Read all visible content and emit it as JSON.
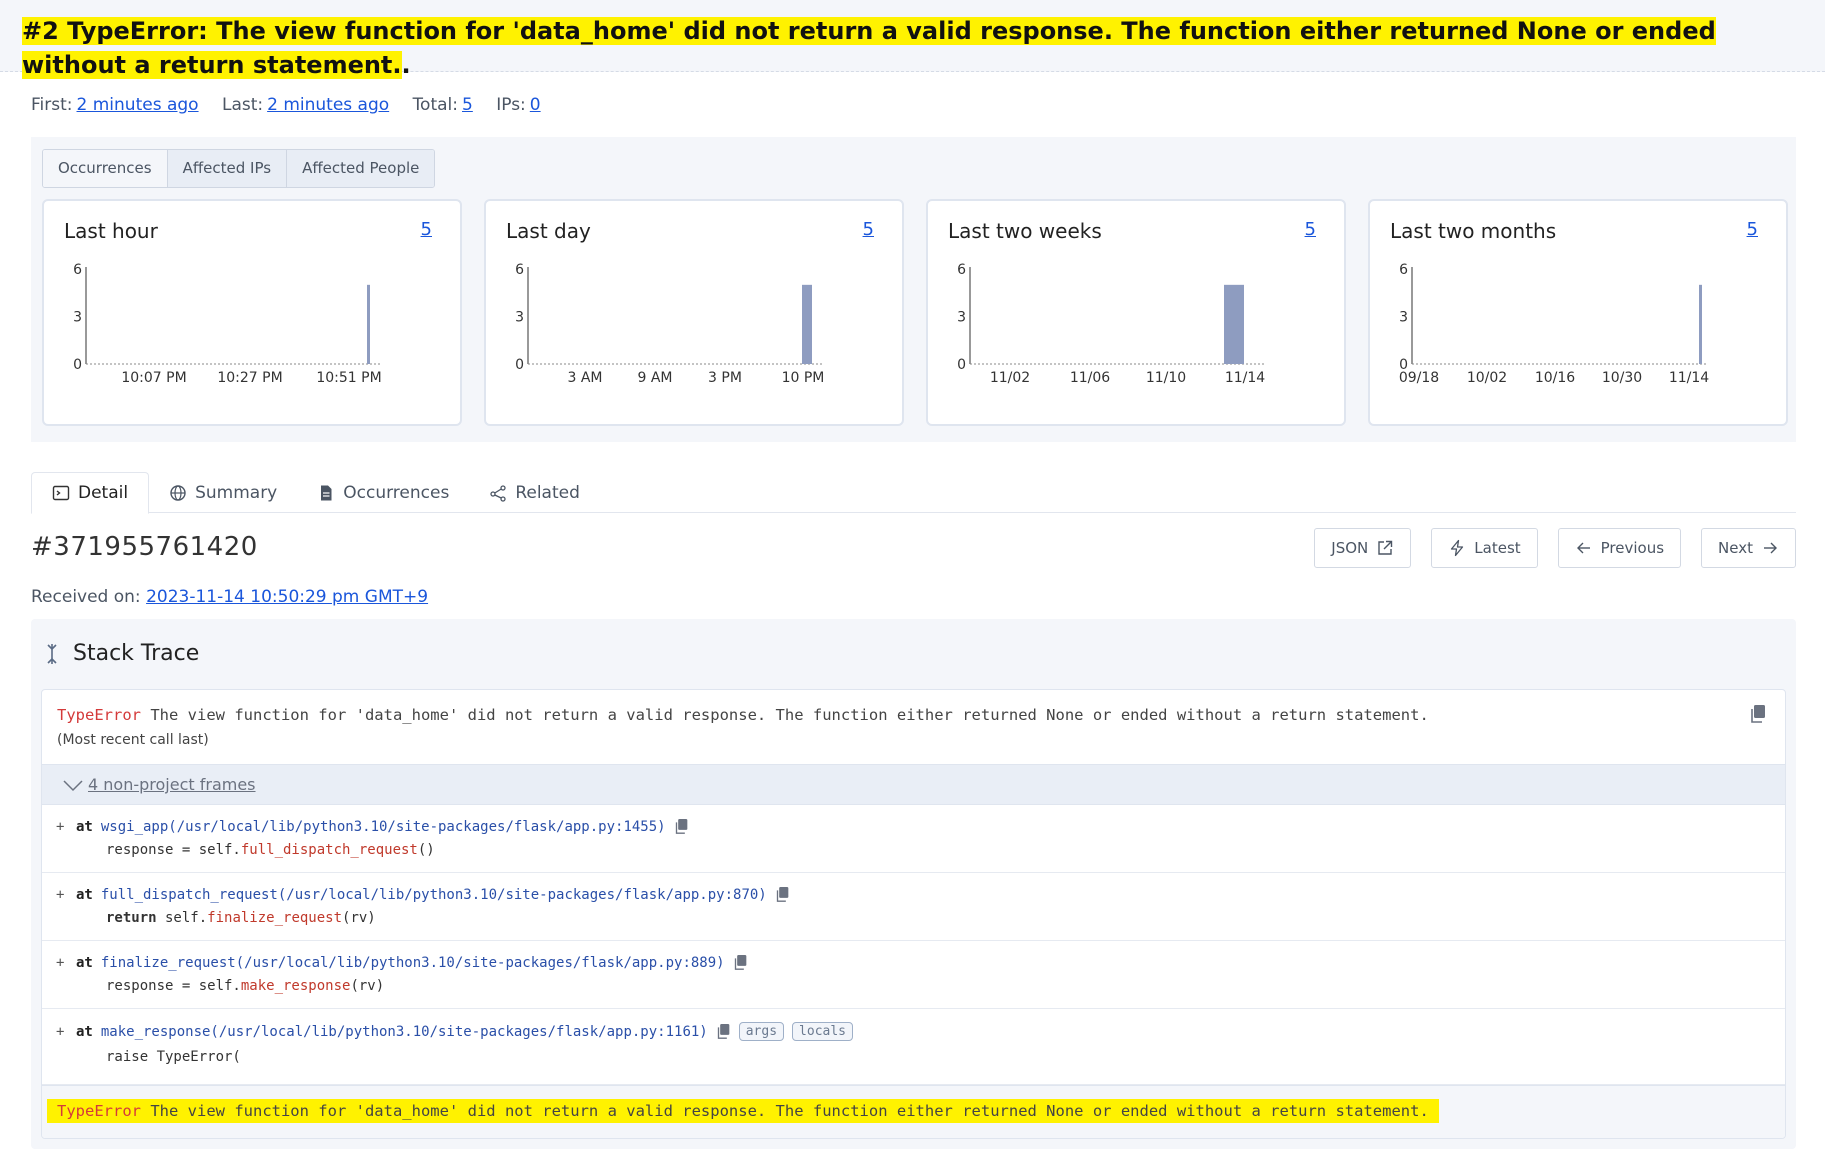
{
  "title": {
    "text": "#2 TypeError: The view function for 'data_home' did not return a valid response. The function either returned None or ended without a return statement.",
    "period": "."
  },
  "meta": {
    "first_label": "First:",
    "first_value": "2 minutes ago",
    "last_label": "Last:",
    "last_value": "2 minutes ago",
    "total_label": "Total:",
    "total_value": "5",
    "ips_label": "IPs:",
    "ips_value": "0"
  },
  "stat_tabs": [
    "Occurrences",
    "Affected IPs",
    "Affected People"
  ],
  "chart_data": [
    {
      "type": "bar",
      "title": "Last hour",
      "count": "5",
      "ylim": [
        0,
        6
      ],
      "yticks": [
        "6",
        "3",
        "0"
      ],
      "xticks": [
        "10:07 PM",
        "10:27 PM",
        "10:51 PM"
      ],
      "bars": [
        {
          "x": "10:51 PM",
          "value": 5
        }
      ]
    },
    {
      "type": "bar",
      "title": "Last day",
      "count": "5",
      "ylim": [
        0,
        6
      ],
      "yticks": [
        "6",
        "3",
        "0"
      ],
      "xticks": [
        "3 AM",
        "9 AM",
        "3 PM",
        "10 PM"
      ],
      "bars": [
        {
          "x": "10 PM",
          "value": 5
        }
      ]
    },
    {
      "type": "bar",
      "title": "Last two weeks",
      "count": "5",
      "ylim": [
        0,
        6
      ],
      "yticks": [
        "6",
        "3",
        "0"
      ],
      "xticks": [
        "11/02",
        "11/06",
        "11/10",
        "11/14"
      ],
      "bars": [
        {
          "x": "11/14",
          "value": 5
        }
      ]
    },
    {
      "type": "bar",
      "title": "Last two months",
      "count": "5",
      "ylim": [
        0,
        6
      ],
      "yticks": [
        "6",
        "3",
        "0"
      ],
      "xticks": [
        "09/18",
        "10/02",
        "10/16",
        "10/30",
        "11/14"
      ],
      "bars": [
        {
          "x": "11/14",
          "value": 5
        }
      ]
    }
  ],
  "detail_tabs": [
    "Detail",
    "Summary",
    "Occurrences",
    "Related"
  ],
  "event": {
    "id": "#371955761420",
    "received_label": "Received on:",
    "received_value": "2023-11-14 10:50:29 pm GMT+9"
  },
  "buttons": {
    "json": "JSON",
    "latest": "Latest",
    "previous": "Previous",
    "next": "Next"
  },
  "stack": {
    "header": "Stack Trace",
    "error_type": "TypeError",
    "error_message": " The view function for 'data_home' did not return a valid response. The function either returned None or ended without a return statement.",
    "recent_call": "(Most recent call last)",
    "non_project": "4 non-project frames",
    "frames": [
      {
        "at": "at",
        "location": "wsgi_app(/usr/local/lib/python3.10/site-packages/flask/app.py:1455)",
        "code_pre": "response = self.",
        "code_kw": "",
        "code_call": "full_dispatch_request",
        "code_post": "()"
      },
      {
        "at": "at",
        "location": "full_dispatch_request(/usr/local/lib/python3.10/site-packages/flask/app.py:870)",
        "code_pre": " self.",
        "code_kw": "return",
        "code_call": "finalize_request",
        "code_post": "(rv)"
      },
      {
        "at": "at",
        "location": "finalize_request(/usr/local/lib/python3.10/site-packages/flask/app.py:889)",
        "code_pre": "response = self.",
        "code_kw": "",
        "code_call": "make_response",
        "code_post": "(rv)"
      },
      {
        "at": "at",
        "location": "make_response(/usr/local/lib/python3.10/site-packages/flask/app.py:1161)",
        "code_pre": "raise TypeError(",
        "code_kw": "",
        "code_call": "",
        "code_post": ""
      }
    ],
    "tags": [
      "args",
      "locals"
    ],
    "plus": "+"
  }
}
